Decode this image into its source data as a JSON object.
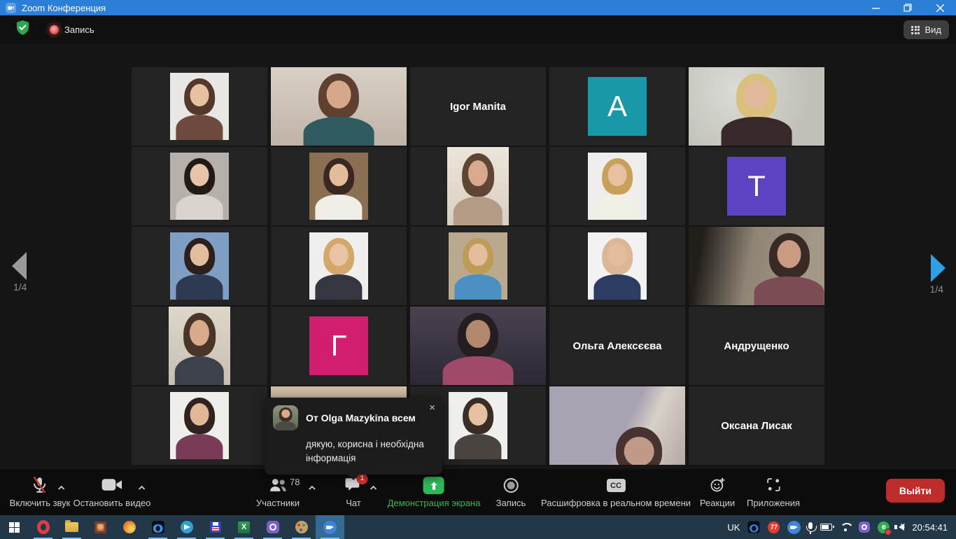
{
  "window": {
    "title": "Zoom Конференция"
  },
  "header": {
    "recording_label": "Запись",
    "view_label": "Вид",
    "icons": [
      "security-shield-icon",
      "recording-dot-icon",
      "grid-view-icon"
    ]
  },
  "stage": {
    "page_left": "1/4",
    "page_right": "1/4"
  },
  "participants": [
    {
      "type": "avatar",
      "bg": "#e9e7e3",
      "person": {
        "hair": "#53382b",
        "skin": "#e6c2a2",
        "top": "#6e4a3c"
      }
    },
    {
      "type": "video",
      "bg": "linear-gradient(#d8cfc6,#c0b4a8)",
      "person": {
        "hair": "#5f4030",
        "skin": "#d6a789",
        "top": "#2e5a60"
      }
    },
    {
      "type": "name",
      "label": "Igor Manita"
    },
    {
      "type": "letter",
      "letter": "A",
      "color": "#1a98a8"
    },
    {
      "type": "video",
      "active": true,
      "bg": "radial-gradient(circle at 35% 30%,#dcdcd6,#bfbfb8 75%)",
      "person": {
        "hair": "#d9c07c",
        "skin": "#e4b89b",
        "top": "#38282a"
      }
    },
    {
      "type": "avatar",
      "bg": "#b5b1aa",
      "person": {
        "hair": "#211b18",
        "skin": "#e7c4a9",
        "top": "#d9d4cd"
      }
    },
    {
      "type": "avatar",
      "bg": "#8a6f52",
      "person": {
        "hair": "#3b2721",
        "skin": "#e3bc99",
        "top": "#f1eee8"
      }
    },
    {
      "type": "video",
      "orientation": "portrait",
      "bg": "linear-gradient(#ece5d9,#d8cfc1)",
      "person": {
        "hair": "#5f4534",
        "skin": "#d8a98c",
        "top": "#b39b86"
      }
    },
    {
      "type": "avatar",
      "bg": "#efeeec",
      "person": {
        "hair": "#c9a05a",
        "skin": "#e8c0a0",
        "top": "#f2efe7"
      }
    },
    {
      "type": "letter",
      "letter": "T",
      "color": "#5d43c1"
    },
    {
      "type": "avatar",
      "bg": "#7f9ec4",
      "person": {
        "hair": "#2b201c",
        "skin": "#e3bd9f",
        "top": "#2e3a52"
      }
    },
    {
      "type": "avatar",
      "bg": "#f0efed",
      "person": {
        "hair": "#d4a86a",
        "skin": "#e9c4a4",
        "top": "#343741"
      }
    },
    {
      "type": "avatar",
      "bg": "#b9a98f",
      "person": {
        "hair": "#bd9c58",
        "skin": "#e6bd9c",
        "top": "#4a90c2"
      }
    },
    {
      "type": "avatar",
      "bg": "#f2f2f2",
      "person": {
        "hair": "#dcb795",
        "skin": "#e3bd9d",
        "top": "#2c3c63"
      }
    },
    {
      "type": "video",
      "variant": "right",
      "bg": "linear-gradient(100deg,#211e1a 10%,#8f8475 45%,#a39787 85%)",
      "person": {
        "hair": "#3a2a26",
        "skin": "#c89b82",
        "top": "#7c4c54"
      }
    },
    {
      "type": "video",
      "orientation": "portrait",
      "bg": "linear-gradient(#ddd6c9,#c7c0b2)",
      "person": {
        "hair": "#4a3628",
        "skin": "#d8ab8c",
        "top": "#3c414c"
      }
    },
    {
      "type": "letter",
      "letter": "Г",
      "color": "#cf1f6e"
    },
    {
      "type": "video",
      "bg": "linear-gradient(#4a4250,#2d2833)",
      "person": {
        "hair": "#241d22",
        "skin": "#b2886f",
        "top": "#9e4a68"
      }
    },
    {
      "type": "name",
      "label": "Ольга Алексєєва"
    },
    {
      "type": "name",
      "label": "Андрущенко"
    },
    {
      "type": "avatar",
      "bg": "#f0eeea",
      "person": {
        "hair": "#2e2320",
        "skin": "#e2b795",
        "top": "#7a3b56"
      }
    },
    {
      "type": "video",
      "bg": "linear-gradient(#cdbaa1,#b7a58d)"
    },
    {
      "type": "avatar",
      "bg": "#efefed",
      "person": {
        "hair": "#3a2d26",
        "skin": "#e6c1a1",
        "top": "#4a4440"
      }
    },
    {
      "type": "video",
      "variant": "bottom",
      "bg": "linear-gradient(115deg,#a8a1b2 55%,#d8d1c8 70%,#b3a9a0)",
      "person": {
        "hair": "#473230",
        "skin": "#c09a86",
        "top": "#6b5b5f"
      }
    },
    {
      "type": "name",
      "label": "Оксана Лисак"
    }
  ],
  "chat_popup": {
    "from_line": "От Olga Mazykina всем",
    "message": "дякую, корисна і необхідна інформація",
    "close_icon": "×"
  },
  "toolbar": {
    "mute": {
      "label": "Включить звук",
      "icon": "microphone-muted-icon"
    },
    "video": {
      "label": "Остановить видео",
      "icon": "camera-icon"
    },
    "participants": {
      "label": "Участники",
      "count": "78",
      "icon": "people-icon"
    },
    "chat": {
      "label": "Чат",
      "badge": "1",
      "icon": "chat-bubble-icon"
    },
    "share": {
      "label": "Демонстрация экрана",
      "icon": "share-screen-arrow-icon",
      "accent": "#2db858"
    },
    "record": {
      "label": "Запись",
      "icon": "record-circle-icon"
    },
    "cc": {
      "label": "Расшифровка в реальном времени",
      "icon_text": "CC"
    },
    "reactions": {
      "label": "Реакции",
      "icon": "smiley-plus-icon"
    },
    "apps": {
      "label": "Приложения",
      "icon": "apps-icon"
    },
    "leave": {
      "label": "Выйти",
      "color": "#bf2c2c"
    }
  },
  "taskbar": {
    "language": "UK",
    "notification_count": "77",
    "time": "20:54:41",
    "apps": [
      {
        "id": "start",
        "running": false,
        "active": false
      },
      {
        "id": "opera",
        "running": true,
        "active": false
      },
      {
        "id": "folder",
        "running": true,
        "active": false
      },
      {
        "id": "photo",
        "running": false,
        "active": false
      },
      {
        "id": "firefox",
        "running": false,
        "active": false
      },
      {
        "id": "wapp",
        "running": true,
        "active": false
      },
      {
        "id": "telegram",
        "running": true,
        "active": false
      },
      {
        "id": "floppy",
        "running": true,
        "active": false
      },
      {
        "id": "excel",
        "running": true,
        "active": false
      },
      {
        "id": "viber",
        "running": true,
        "active": false
      },
      {
        "id": "palette",
        "running": true,
        "active": false
      },
      {
        "id": "zoomcam",
        "running": true,
        "active": true
      }
    ],
    "tray_icons": [
      "wapp-icon",
      "notification-badge",
      "zoom-icon",
      "microphone-icon",
      "battery-icon",
      "wifi-icon",
      "viber-icon",
      "antivirus-icon",
      "speaker-muted-icon"
    ]
  }
}
